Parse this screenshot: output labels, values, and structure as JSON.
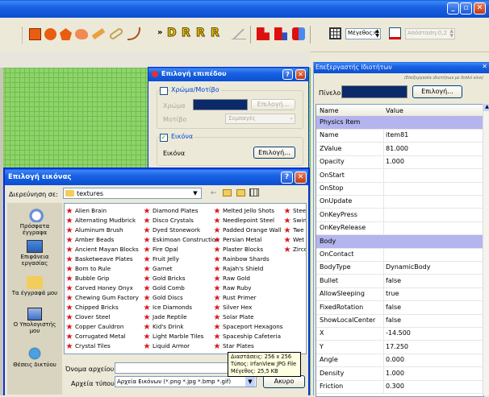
{
  "toolbar": {
    "size_label": "Μέγεθος:6",
    "distance_label": "Απόσταση:0,2",
    "double_arrow": "»",
    "letter_buttons": [
      "D",
      "R",
      "R",
      "R"
    ]
  },
  "layer_dialog": {
    "title": "Επιλογή επιπέδου",
    "color_pattern_checkbox": "Χρώμα/Μοτίβο",
    "color_label": "Χρώμα",
    "color_select_button": "Επιλογή...",
    "pattern_label": "Μοτίβο",
    "pattern_value": "Συμπαγές",
    "image_checkbox": "Εικόνα",
    "image_label": "Εικόνα",
    "image_select_button": "Επιλογή..."
  },
  "props_panel": {
    "title": "Επεξεργαστής Ιδιοτήτων",
    "hint": "(Επεξεργασία ιδιοτήτων με διπλό κλικ)",
    "level_label": "Πίνελο",
    "level_select_button": "Επιλογή...",
    "col_name": "Name",
    "col_value": "Value",
    "rows": [
      {
        "k": "Physics Item",
        "v": "",
        "section": true
      },
      {
        "k": "Name",
        "v": "item81"
      },
      {
        "k": "ZValue",
        "v": "81.000"
      },
      {
        "k": "Opacity",
        "v": "1.000"
      },
      {
        "k": "OnStart",
        "v": ""
      },
      {
        "k": "OnStop",
        "v": ""
      },
      {
        "k": "OnUpdate",
        "v": ""
      },
      {
        "k": "OnKeyPress",
        "v": ""
      },
      {
        "k": "OnKeyRelease",
        "v": ""
      },
      {
        "k": "Body",
        "v": "",
        "section": true
      },
      {
        "k": "OnContact",
        "v": ""
      },
      {
        "k": "BodyType",
        "v": "DynamicBody"
      },
      {
        "k": "Bullet",
        "v": "false"
      },
      {
        "k": "AllowSleeping",
        "v": "true"
      },
      {
        "k": "FixedRotation",
        "v": "false"
      },
      {
        "k": "ShowLocalCenter",
        "v": "false"
      },
      {
        "k": "X",
        "v": "-14.500"
      },
      {
        "k": "Y",
        "v": "17.250"
      },
      {
        "k": "Angle",
        "v": "0.000"
      },
      {
        "k": "Density",
        "v": "1.000"
      },
      {
        "k": "Friction",
        "v": "0.300"
      }
    ]
  },
  "file_dialog": {
    "title": "Επιλογή εικόνας",
    "look_in_label": "Διερεύνηση σε:",
    "look_in_value": "textures",
    "places": [
      {
        "label": "Πρόσφατα έγγραφα",
        "icon": "recent-documents-icon"
      },
      {
        "label": "Επιφάνεια εργασίας",
        "icon": "desktop-icon"
      },
      {
        "label": "Τα έγγραφά μου",
        "icon": "my-documents-icon"
      },
      {
        "label": "Ο Υπολογιστής μου",
        "icon": "my-computer-icon"
      },
      {
        "label": "Θέσεις δικτύου",
        "icon": "network-places-icon"
      }
    ],
    "files_col1": [
      "Alien Brain",
      "Alternating Mudbrick",
      "Aluminum Brush",
      "Amber Beads",
      "Ancient Mayan Blocks",
      "Basketweave Plates",
      "Born to Rule",
      "Bubble Grip",
      "Carved Honey Onyx",
      "Chewing Gum Factory",
      "Chipped Bricks",
      "Clover Steel",
      "Copper Cauldron",
      "Corrugated Metal",
      "Crystal Tiles"
    ],
    "files_col2": [
      "Diamond Plates",
      "Disco Crystals",
      "Dyed Stonework",
      "Eskimoan Construction",
      "Fire Opal",
      "Fruit Jelly",
      "Garnet",
      "Gold Bricks",
      "Gold Comb",
      "Gold Discs",
      "Ice Diamonds",
      "Jade Reptile",
      "Kid's Drink",
      "Light Marble Tiles",
      "Liquid Armor"
    ],
    "files_col3": [
      "Melted Jello Shots",
      "Needlepoint Steel",
      "Padded Orange Wall",
      "Persian Metal",
      "Plaster Blocks",
      "Rainbow Shards",
      "Rajah's Shield",
      "Raw Gold",
      "Raw Ruby",
      "Rust Primer",
      "Silver Hex",
      "Solar Plate",
      "Spaceport Hexagons",
      "Spaceship Cafeteria",
      "Star Plates"
    ],
    "files_col4": [
      "Stee",
      "Swin",
      "Twe",
      "Wet",
      "Zirco"
    ],
    "filename_label": "Όνομα αρχείου:",
    "filetype_label": "Αρχεία τύπου:",
    "filetype_value": "Αρχεία Εικόνων (*.png *.jpg *.bmp *.gif)",
    "cancel_partial": "Ακυρο",
    "tooltip": {
      "dimensions": "Διαστάσεις: 256 x 256",
      "type": "Τύπος: IrfanView JPG File",
      "size": "Μέγεθος: 25,5 KB"
    }
  }
}
